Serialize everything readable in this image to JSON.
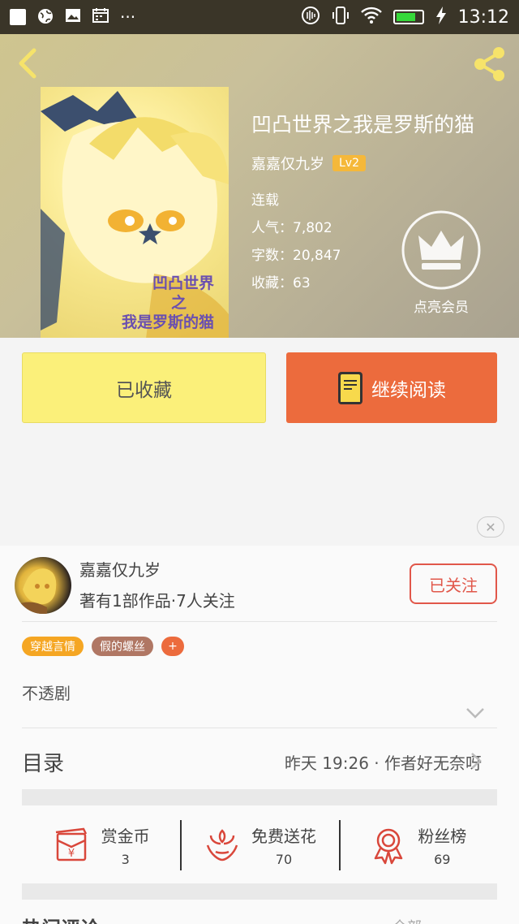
{
  "status_bar": {
    "time": "13:12",
    "more": "···"
  },
  "book": {
    "title": "凹凸世界之我是罗斯的猫",
    "cover_text": [
      "凹凸世界",
      "之",
      "我是罗斯的猫"
    ],
    "author": "嘉嘉仅九岁",
    "level": "Lv2",
    "status": "连载",
    "popularity": "人气：7,802",
    "word_count": "字数：20,847",
    "favorites": "收藏：63",
    "vip_label": "点亮会员"
  },
  "actions": {
    "favorited_label": "已收藏",
    "continue_label": "继续阅读"
  },
  "author_card": {
    "name": "嘉嘉仅九岁",
    "meta": "著有1部作品·7人关注",
    "follow_label": "已关注"
  },
  "tags": [
    {
      "label": "穿越言情"
    },
    {
      "label": "假的螺丝"
    }
  ],
  "tag_add": "+",
  "summary": "不透剧",
  "catalog": {
    "label": "目录",
    "update": "昨天 19:26 · 作者好无奈呀"
  },
  "stats": [
    {
      "label": "赏金币",
      "value": "3",
      "icon": "red-envelope-icon"
    },
    {
      "label": "免费送花",
      "value": "70",
      "icon": "flower-icon"
    },
    {
      "label": "粉丝榜",
      "value": "69",
      "icon": "medal-icon"
    }
  ],
  "hot_comments": {
    "title": "热门评论",
    "all_label": "全部"
  },
  "colors": {
    "accent": "#ec6b3d",
    "favorite": "#fbf07a",
    "follow": "#e1574a"
  }
}
